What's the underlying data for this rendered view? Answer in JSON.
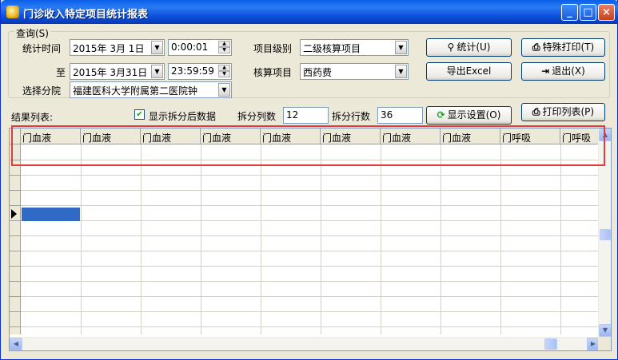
{
  "window": {
    "title": "门诊收入特定项目统计报表"
  },
  "query": {
    "group_label": "查询(S)",
    "time_label": "统计时间",
    "start_date": "2015年 3月 1日",
    "start_time": "0:00:01",
    "to_label": "至",
    "end_date": "2015年 3月31日",
    "end_time": "23:59:59",
    "branch_label": "选择分院",
    "branch_value": "福建医科大学附属第二医院钟",
    "level_label": "项目级别",
    "level_value": "二级核算项目",
    "item_label": "核算项目",
    "item_value": "西药费"
  },
  "buttons": {
    "stats": "统计(U)",
    "special_print": "特殊打印(T)",
    "export": "导出Excel",
    "exit": "退出(X)",
    "display_settings": "显示设置(O)",
    "print_list": "打印列表(P)"
  },
  "options": {
    "result_label": "结果列表:",
    "show_split_label": "显示拆分后数据",
    "show_split_checked": true,
    "split_cols_label": "拆分列数",
    "split_cols_value": "12",
    "split_rows_label": "拆分行数",
    "split_rows_value": "36"
  },
  "grid": {
    "headers": [
      "门血液",
      "门血液",
      "门血液",
      "门血液",
      "门血液",
      "门血液",
      "门血液",
      "门血液",
      "门呼吸",
      "门呼吸"
    ]
  },
  "colors": {
    "highlight": "#E33A3A",
    "selection": "#316AC5",
    "titlebar": "#0A5FE8"
  }
}
